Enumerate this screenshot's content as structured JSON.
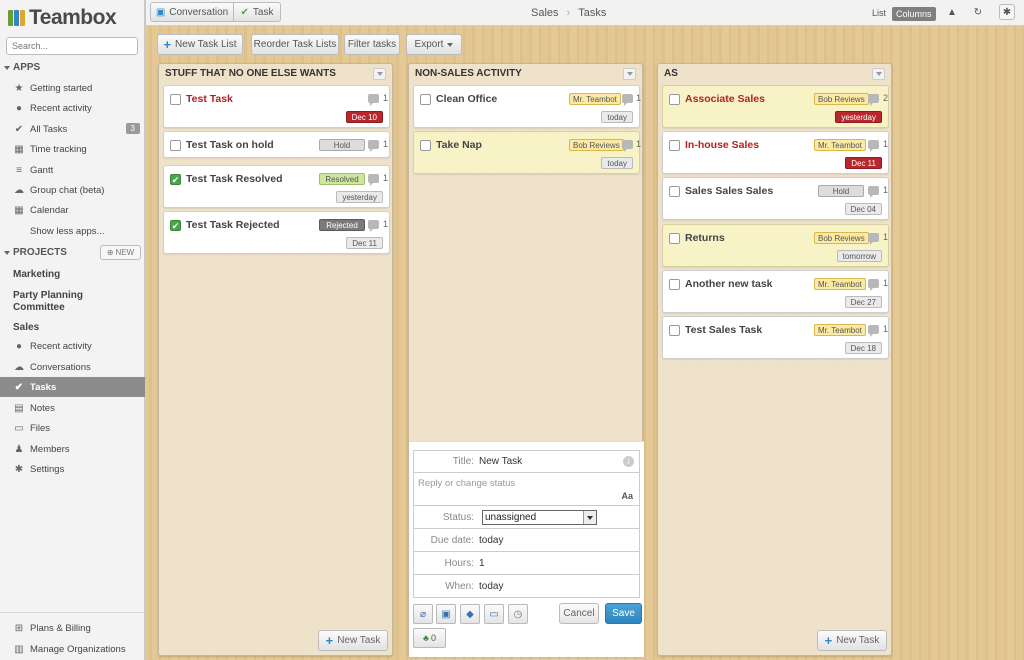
{
  "app": {
    "name": "Teambox",
    "search_placeholder": "Search..."
  },
  "sidebar": {
    "apps_header": "APPS",
    "apps": [
      {
        "label": "Getting started",
        "icon": "star-icon"
      },
      {
        "label": "Recent activity",
        "icon": "activity-icon"
      },
      {
        "label": "All Tasks",
        "icon": "check-circle-icon",
        "count": "3"
      },
      {
        "label": "Time tracking",
        "icon": "calendar-icon"
      },
      {
        "label": "Gantt",
        "icon": "gantt-icon"
      },
      {
        "label": "Group chat (beta)",
        "icon": "chat-icon"
      },
      {
        "label": "Calendar",
        "icon": "calendar-icon"
      }
    ],
    "show_less": "Show less apps...",
    "projects_header": "PROJECTS",
    "new_label": "NEW",
    "projects": [
      "Marketing",
      "Party Planning Committee",
      "Sales"
    ],
    "project_items": [
      {
        "label": "Recent activity",
        "icon": "activity-icon"
      },
      {
        "label": "Conversations",
        "icon": "conversations-icon"
      },
      {
        "label": "Tasks",
        "icon": "check-icon",
        "active": true
      },
      {
        "label": "Notes",
        "icon": "note-icon"
      },
      {
        "label": "Files",
        "icon": "folder-icon"
      },
      {
        "label": "Members",
        "icon": "members-icon"
      },
      {
        "label": "Settings",
        "icon": "gear-icon"
      }
    ],
    "bottom": [
      {
        "label": "Plans & Billing",
        "icon": "cart-icon"
      },
      {
        "label": "Manage Organizations",
        "icon": "building-icon"
      }
    ]
  },
  "topbar": {
    "conversation": "Conversation",
    "task": "Task",
    "breadcrumb": [
      "Sales",
      "Tasks"
    ],
    "view_list": "List",
    "view_columns": "Columns"
  },
  "toolbar": {
    "new_task_list": "New Task List",
    "reorder": "Reorder Task Lists",
    "filter": "Filter tasks",
    "export": "Export"
  },
  "columns": [
    {
      "title": "STUFF THAT NO ONE ELSE WANTS",
      "cards": [
        {
          "title": "Test Task",
          "red": true,
          "checked": false,
          "comments": "1",
          "date": "Dec 10",
          "date_red": true
        },
        {
          "title": "Test Task on hold",
          "checked": false,
          "comments": "1",
          "tag": "Hold",
          "tag_style": "gray"
        },
        {
          "title": "Test Task Resolved",
          "checked": true,
          "comments": "1",
          "tag": "Resolved",
          "tag_style": "green",
          "date": "yesterday"
        },
        {
          "title": "Test Task Rejected",
          "checked": true,
          "comments": "1",
          "tag": "Rejected",
          "tag_style": "dark",
          "date": "Dec 11"
        }
      ]
    },
    {
      "title": "NON-SALES ACTIVITY",
      "cards": [
        {
          "title": "Clean Office",
          "checked": false,
          "comments": "1",
          "tag": "Mr. Teambot",
          "tag_style": "yellow",
          "date": "today"
        },
        {
          "title": "Take Nap",
          "checked": false,
          "comments": "1",
          "tag": "Bob Reviews",
          "tag_style": "yellow",
          "date": "today",
          "yellow": true
        }
      ]
    },
    {
      "title": "AS",
      "cards": [
        {
          "title": "Associate Sales",
          "red": true,
          "checked": false,
          "comments": "2",
          "tag": "Bob Reviews",
          "tag_style": "yellow",
          "date": "yesterday",
          "date_red": true,
          "yellow": true
        },
        {
          "title": "In-house Sales",
          "red": true,
          "checked": false,
          "comments": "1",
          "tag": "Mr. Teambot",
          "tag_style": "yellow",
          "date": "Dec 11",
          "date_red": true
        },
        {
          "title": "Sales Sales Sales",
          "checked": false,
          "comments": "1",
          "tag": "Hold",
          "tag_style": "gray",
          "date": "Dec 04"
        },
        {
          "title": "Returns",
          "checked": false,
          "comments": "1",
          "tag": "Bob Reviews",
          "tag_style": "yellow",
          "date": "tomorrow",
          "yellow": true
        },
        {
          "title": "Another new task",
          "checked": false,
          "comments": "1",
          "tag": "Mr. Teambot",
          "tag_style": "yellow",
          "date": "Dec 27"
        },
        {
          "title": "Test Sales Task",
          "checked": false,
          "comments": "1",
          "tag": "Mr. Teambot",
          "tag_style": "yellow",
          "date": "Dec 18"
        }
      ]
    }
  ],
  "form": {
    "title_label": "Title:",
    "title_value": "New Task",
    "reply_placeholder": "Reply or change status",
    "font_toggle": "Aa",
    "status_label": "Status:",
    "status_value": "unassigned",
    "due_label": "Due date:",
    "due_value": "today",
    "hours_label": "Hours:",
    "hours_value": "1",
    "when_label": "When:",
    "when_value": "today",
    "cancel": "Cancel",
    "save": "Save",
    "watchers_count": "0"
  },
  "new_task": "New Task",
  "colors": {
    "accent": "#2d85bd",
    "overdue": "#b8272b"
  }
}
